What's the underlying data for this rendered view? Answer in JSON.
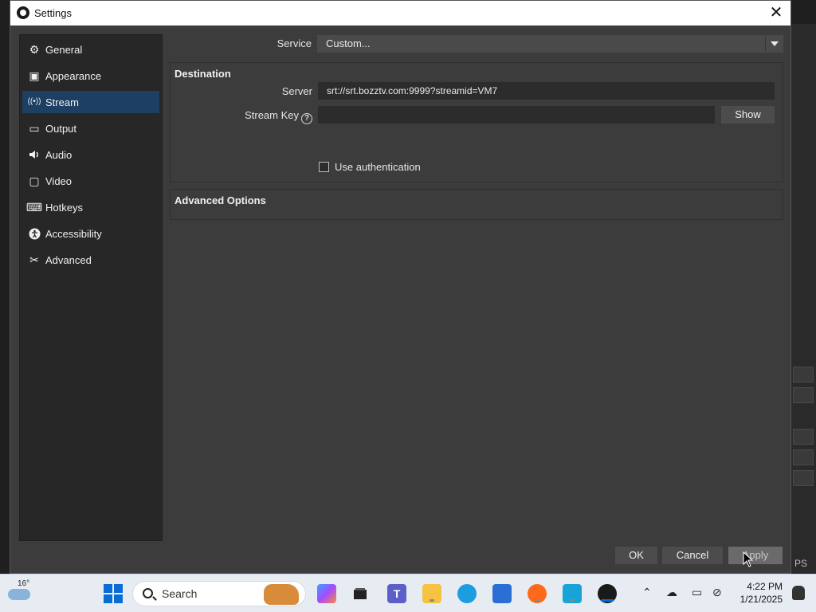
{
  "window": {
    "title": "Settings",
    "close_glyph": "✕"
  },
  "sidebar": {
    "items": [
      {
        "label": "General",
        "icon": "gear-icon",
        "glyph": "⚙",
        "active": false
      },
      {
        "label": "Appearance",
        "icon": "appearance-icon",
        "glyph": "▣",
        "active": false
      },
      {
        "label": "Stream",
        "icon": "antenna-icon",
        "glyph": "((•))",
        "active": true
      },
      {
        "label": "Output",
        "icon": "output-icon",
        "glyph": "▭",
        "active": false
      },
      {
        "label": "Audio",
        "icon": "speaker-icon",
        "glyph": "🔊",
        "active": false
      },
      {
        "label": "Video",
        "icon": "monitor-icon",
        "glyph": "▢",
        "active": false
      },
      {
        "label": "Hotkeys",
        "icon": "keyboard-icon",
        "glyph": "⌨",
        "active": false
      },
      {
        "label": "Accessibility",
        "icon": "accessibility-icon",
        "glyph": "♿",
        "active": false
      },
      {
        "label": "Advanced",
        "icon": "tools-icon",
        "glyph": "✂",
        "active": false
      }
    ]
  },
  "stream": {
    "service_label": "Service",
    "service_value": "Custom...",
    "destination_title": "Destination",
    "server_label": "Server",
    "server_value": "srt://srt.bozztv.com:9999?streamid=VM7",
    "stream_key_label": "Stream Key",
    "stream_key_value": "",
    "help_glyph": "?",
    "show_button": "Show",
    "use_auth_label": "Use authentication",
    "use_auth_checked": false,
    "advanced_title": "Advanced Options"
  },
  "footer": {
    "ok": "OK",
    "cancel": "Cancel",
    "apply": "Apply"
  },
  "background": {
    "right_text": "PS"
  },
  "taskbar": {
    "weather_temp": "16°",
    "search_placeholder": "Search",
    "time": "4:22 PM",
    "date": "1/21/2025",
    "apps": [
      "copilot-icon",
      "file-manager-icon",
      "teams-icon",
      "folder-icon",
      "edge-icon",
      "store-icon",
      "firefox-icon",
      "notepad-icon",
      "obs-icon"
    ]
  },
  "colors": {
    "accent": "#1c3f63",
    "dialog_bg": "#3c3c3c",
    "sidebar_bg": "#272727"
  }
}
